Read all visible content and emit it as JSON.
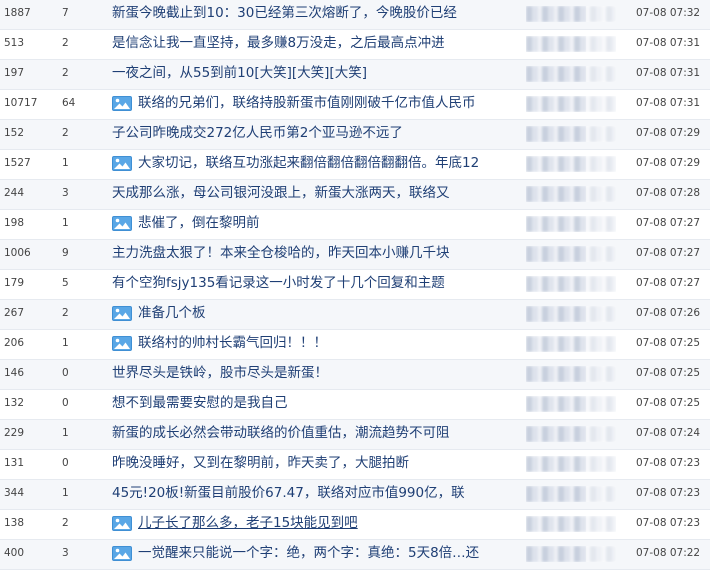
{
  "posts": [
    {
      "reads": "1887",
      "replies": "7",
      "has_image": false,
      "underlined": false,
      "title": "新蛋今晚截止到10：30已经第三次熔断了，今晚股价已经",
      "time": "07-08  07:32"
    },
    {
      "reads": "513",
      "replies": "2",
      "has_image": false,
      "underlined": false,
      "title": "是信念让我一直坚持，最多赚8万没走，之后最高点冲进",
      "time": "07-08  07:31"
    },
    {
      "reads": "197",
      "replies": "2",
      "has_image": false,
      "underlined": false,
      "title": "一夜之间，从55到前10[大笑][大笑][大笑]",
      "time": "07-08  07:31"
    },
    {
      "reads": "10717",
      "replies": "64",
      "has_image": true,
      "underlined": false,
      "title": "联络的兄弟们，联络持股新蛋市值刚刚破千亿市值人民币",
      "time": "07-08  07:31"
    },
    {
      "reads": "152",
      "replies": "2",
      "has_image": false,
      "underlined": false,
      "title": "子公司昨晚成交272亿人民币第2个亚马逊不远了",
      "time": "07-08  07:29"
    },
    {
      "reads": "1527",
      "replies": "1",
      "has_image": true,
      "underlined": false,
      "title": "大家切记，联络互功涨起来翻倍翻倍翻倍翻翻倍。年底12",
      "time": "07-08  07:29"
    },
    {
      "reads": "244",
      "replies": "3",
      "has_image": false,
      "underlined": false,
      "title": "天成那么涨，母公司银河没跟上，新蛋大涨两天，联络又",
      "time": "07-08  07:28"
    },
    {
      "reads": "198",
      "replies": "1",
      "has_image": true,
      "underlined": false,
      "title": "悲催了，倒在黎明前",
      "time": "07-08  07:27"
    },
    {
      "reads": "1006",
      "replies": "9",
      "has_image": false,
      "underlined": false,
      "title": "主力洗盘太狠了！本来全仓梭哈的，昨天回本小赚几千块",
      "time": "07-08  07:27"
    },
    {
      "reads": "179",
      "replies": "5",
      "has_image": false,
      "underlined": false,
      "title": "有个空狗fsjy135看记录这一小时发了十几个回复和主题",
      "time": "07-08  07:27"
    },
    {
      "reads": "267",
      "replies": "2",
      "has_image": true,
      "underlined": false,
      "title": "准备几个板",
      "time": "07-08  07:26"
    },
    {
      "reads": "206",
      "replies": "1",
      "has_image": true,
      "underlined": false,
      "title": "联络村的帅村长霸气回归！！！",
      "time": "07-08  07:25"
    },
    {
      "reads": "146",
      "replies": "0",
      "has_image": false,
      "underlined": false,
      "title": "世界尽头是铁岭，股市尽头是新蛋！",
      "time": "07-08  07:25"
    },
    {
      "reads": "132",
      "replies": "0",
      "has_image": false,
      "underlined": false,
      "title": "想不到最需要安慰的是我自己",
      "time": "07-08  07:25"
    },
    {
      "reads": "229",
      "replies": "1",
      "has_image": false,
      "underlined": false,
      "title": "新蛋的成长必然会带动联络的价值重估，潮流趋势不可阻",
      "time": "07-08  07:24"
    },
    {
      "reads": "131",
      "replies": "0",
      "has_image": false,
      "underlined": false,
      "title": "昨晚没睡好，又到在黎明前，昨天卖了，大腿拍断",
      "time": "07-08  07:23"
    },
    {
      "reads": "344",
      "replies": "1",
      "has_image": false,
      "underlined": false,
      "title": "45元!20板!新蛋目前股价67.47，联络对应市值990亿，联",
      "time": "07-08  07:23"
    },
    {
      "reads": "138",
      "replies": "2",
      "has_image": true,
      "underlined": true,
      "title": "儿子长了那么多，老子15块能见到吧",
      "time": "07-08  07:23"
    },
    {
      "reads": "400",
      "replies": "3",
      "has_image": true,
      "underlined": false,
      "title": "一觉醒来只能说一个字：绝，两个字：真绝：5天8倍…还",
      "time": "07-08  07:22"
    }
  ]
}
